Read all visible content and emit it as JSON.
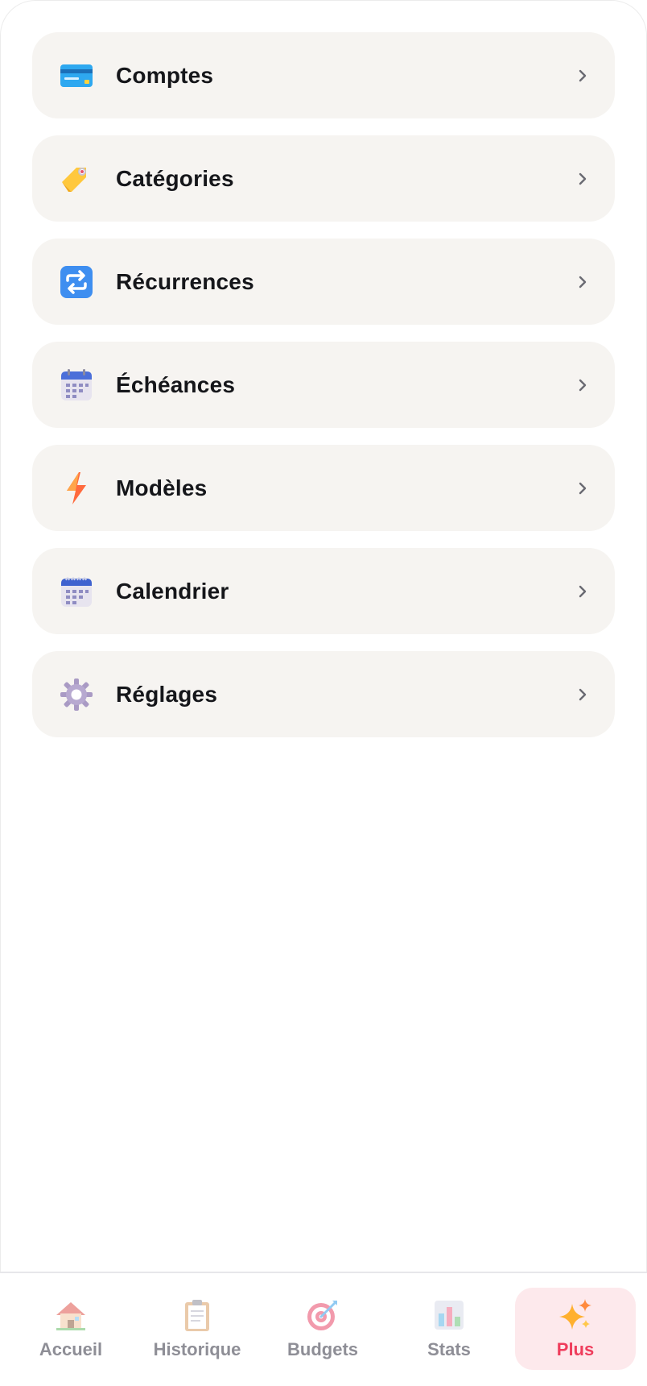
{
  "menu": {
    "items": [
      {
        "label": "Comptes",
        "icon": "credit-card-icon"
      },
      {
        "label": "Catégories",
        "icon": "label-tag-icon"
      },
      {
        "label": "Récurrences",
        "icon": "repeat-icon"
      },
      {
        "label": "Échéances",
        "icon": "calendar-icon"
      },
      {
        "label": "Modèles",
        "icon": "lightning-icon"
      },
      {
        "label": "Calendrier",
        "icon": "spiral-calendar-icon"
      },
      {
        "label": "Réglages",
        "icon": "gear-icon"
      }
    ]
  },
  "tabbar": {
    "tabs": [
      {
        "label": "Accueil",
        "icon": "house-icon"
      },
      {
        "label": "Historique",
        "icon": "clipboard-icon"
      },
      {
        "label": "Budgets",
        "icon": "target-icon"
      },
      {
        "label": "Stats",
        "icon": "bar-chart-icon"
      },
      {
        "label": "Plus",
        "icon": "sparkles-icon",
        "active": true
      }
    ]
  },
  "colors": {
    "accent": "#ef3d5c",
    "active_tab_bg": "#fde9ec",
    "card_bg": "#f6f4f1"
  }
}
